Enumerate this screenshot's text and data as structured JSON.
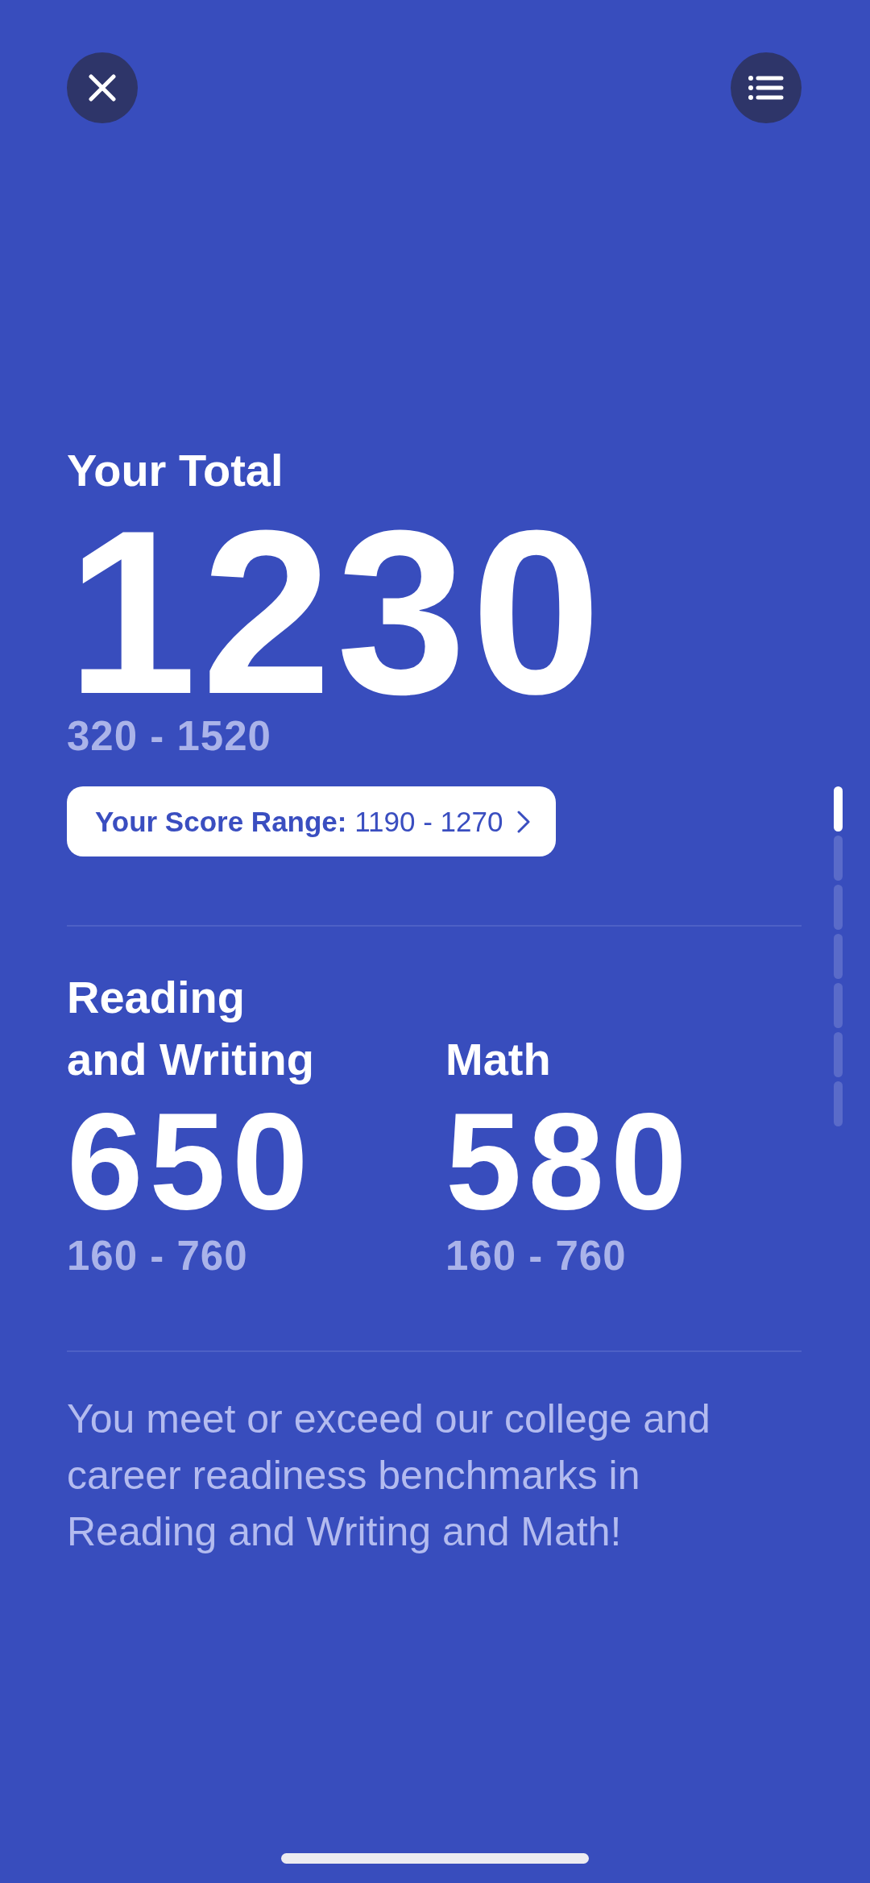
{
  "total": {
    "label": "Your Total",
    "score": "1230",
    "range": "320 - 1520",
    "score_range": {
      "label": "Your Score Range:",
      "value": "1190 - 1270"
    }
  },
  "sections": [
    {
      "label": "Reading and Writing",
      "score": "650",
      "range": "160 - 760"
    },
    {
      "label": "Math",
      "score": "580",
      "range": "160 - 760"
    }
  ],
  "message": "You meet or exceed our college and career readiness benchmarks in Reading and Writing and Math!",
  "page_indicator": [
    {
      "selected": true
    },
    {
      "selected": false
    },
    {
      "selected": false
    },
    {
      "selected": false
    },
    {
      "selected": false
    },
    {
      "selected": false
    },
    {
      "selected": false
    }
  ]
}
